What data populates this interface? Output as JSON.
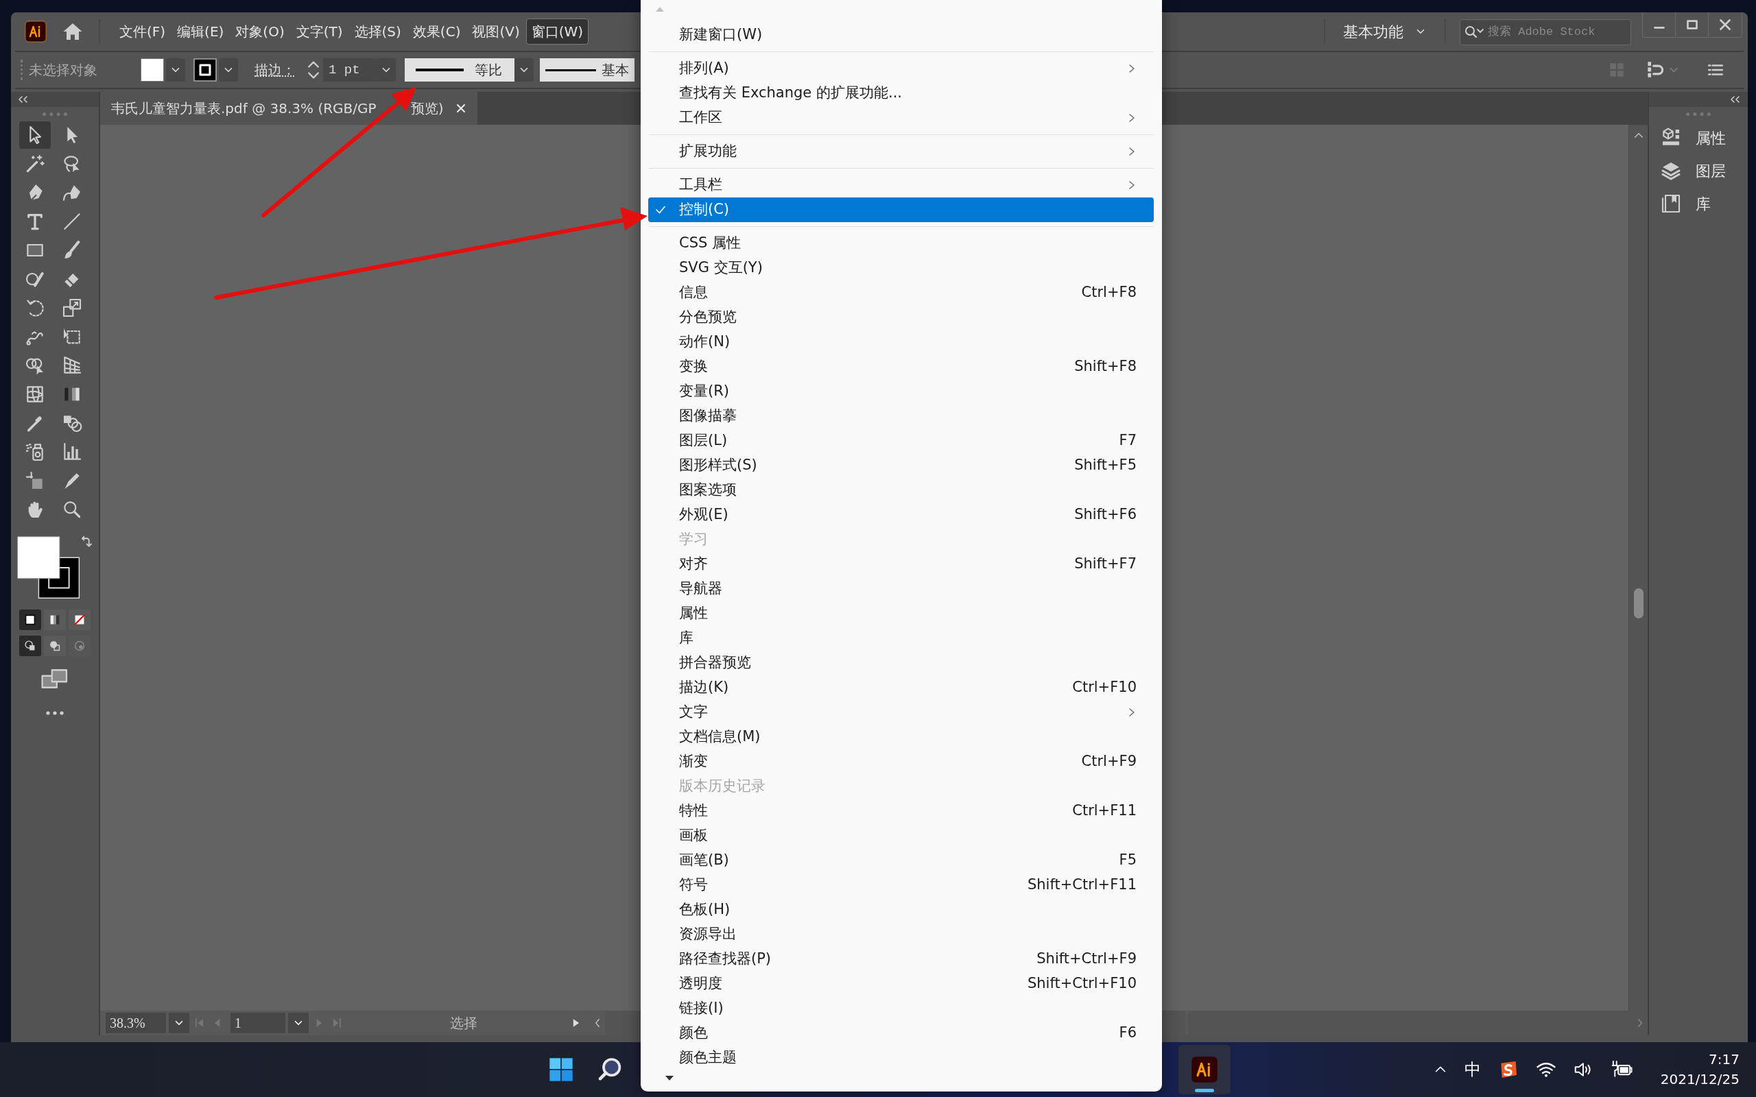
{
  "menu_bar": {
    "items": [
      {
        "label": "文件(F)",
        "selected": false
      },
      {
        "label": "编辑(E)",
        "selected": false
      },
      {
        "label": "对象(O)",
        "selected": false
      },
      {
        "label": "文字(T)",
        "selected": false
      },
      {
        "label": "选择(S)",
        "selected": false
      },
      {
        "label": "效果(C)",
        "selected": false
      },
      {
        "label": "视图(V)",
        "selected": false
      },
      {
        "label": "窗口(W)",
        "selected": true
      }
    ],
    "workspace": "基本功能",
    "search": {
      "placeholder": "搜索 Adobe Stock"
    }
  },
  "control_bar": {
    "selection": "未选择对象",
    "stroke_label": "描边：",
    "stroke_weight": "1 pt",
    "profile": "等比",
    "brush": "基本"
  },
  "document_tab": {
    "title_parts": [
      "韦氏儿童智力量表.pdf @ 38.3% (RGB/GP",
      "预览)"
    ]
  },
  "toolbar": {
    "tools": [
      {
        "kind": "selection",
        "selected": true
      },
      {
        "kind": "direct",
        "selected": false
      },
      {
        "kind": "wand",
        "selected": false
      },
      {
        "kind": "lasso",
        "selected": false
      },
      {
        "kind": "pen",
        "selected": false
      },
      {
        "kind": "curvature",
        "selected": false
      },
      {
        "kind": "type",
        "selected": false
      },
      {
        "kind": "line",
        "selected": false
      },
      {
        "kind": "rectangle",
        "selected": false
      },
      {
        "kind": "brush",
        "selected": false
      },
      {
        "kind": "shaper",
        "selected": false
      },
      {
        "kind": "eraser",
        "selected": false
      },
      {
        "kind": "rotate",
        "selected": false
      },
      {
        "kind": "scale",
        "selected": false
      },
      {
        "kind": "warp",
        "selected": false
      },
      {
        "kind": "free_transform",
        "selected": false
      },
      {
        "kind": "shape_builder",
        "selected": false
      },
      {
        "kind": "perspective",
        "selected": false
      },
      {
        "kind": "mesh",
        "selected": false
      },
      {
        "kind": "gradient",
        "selected": false
      },
      {
        "kind": "eyedropper",
        "selected": false
      },
      {
        "kind": "blend",
        "selected": false
      },
      {
        "kind": "sprayer",
        "selected": false
      },
      {
        "kind": "chart",
        "selected": false
      },
      {
        "kind": "artboard",
        "selected": false
      },
      {
        "kind": "knife",
        "selected": false
      },
      {
        "kind": "hand",
        "selected": false
      },
      {
        "kind": "zoom",
        "selected": false
      }
    ],
    "color_modes": [
      {
        "kind": "color",
        "selected": true
      },
      {
        "kind": "gradient",
        "selected": false
      },
      {
        "kind": "none",
        "selected": false
      }
    ],
    "draw_modes": [
      {
        "kind": "normal",
        "selected": true,
        "disabled": false
      },
      {
        "kind": "behind",
        "selected": false,
        "disabled": false
      },
      {
        "kind": "inside",
        "selected": false,
        "disabled": true
      }
    ]
  },
  "panels": [
    {
      "kind": "properties",
      "label": "属性"
    },
    {
      "kind": "layers",
      "label": "图层"
    },
    {
      "kind": "libraries",
      "label": "库"
    }
  ],
  "status_bar": {
    "zoom": "38.3%",
    "artboard": "1",
    "tool": "选择"
  },
  "window_menu": {
    "items": [
      {
        "kind": "item",
        "label": "新建窗口(W)",
        "submenu": false,
        "checked": false,
        "selected": false,
        "disabled": false
      },
      {
        "kind": "separator"
      },
      {
        "kind": "item",
        "label": "排列(A)",
        "submenu": true,
        "checked": false,
        "selected": false,
        "disabled": false
      },
      {
        "kind": "item",
        "label": "查找有关 Exchange 的扩展功能...",
        "submenu": false,
        "checked": false,
        "selected": false,
        "disabled": false
      },
      {
        "kind": "item",
        "label": "工作区",
        "submenu": true,
        "checked": false,
        "selected": false,
        "disabled": false
      },
      {
        "kind": "separator"
      },
      {
        "kind": "item",
        "label": "扩展功能",
        "submenu": true,
        "checked": false,
        "selected": false,
        "disabled": false
      },
      {
        "kind": "separator"
      },
      {
        "kind": "item",
        "label": "工具栏",
        "submenu": true,
        "checked": false,
        "selected": false,
        "disabled": false
      },
      {
        "kind": "item",
        "label": "控制(C)",
        "submenu": false,
        "checked": true,
        "selected": true,
        "disabled": false
      },
      {
        "kind": "separator"
      },
      {
        "kind": "item",
        "label": "CSS 属性",
        "submenu": false,
        "checked": false,
        "selected": false,
        "disabled": false
      },
      {
        "kind": "item",
        "label": "SVG 交互(Y)",
        "submenu": false,
        "checked": false,
        "selected": false,
        "disabled": false
      },
      {
        "kind": "item",
        "label": "信息",
        "shortcut": "Ctrl+F8",
        "submenu": false,
        "checked": false,
        "selected": false,
        "disabled": false
      },
      {
        "kind": "item",
        "label": "分色预览",
        "submenu": false,
        "checked": false,
        "selected": false,
        "disabled": false
      },
      {
        "kind": "item",
        "label": "动作(N)",
        "submenu": false,
        "checked": false,
        "selected": false,
        "disabled": false
      },
      {
        "kind": "item",
        "label": "变换",
        "shortcut": "Shift+F8",
        "submenu": false,
        "checked": false,
        "selected": false,
        "disabled": false
      },
      {
        "kind": "item",
        "label": "变量(R)",
        "submenu": false,
        "checked": false,
        "selected": false,
        "disabled": false
      },
      {
        "kind": "item",
        "label": "图像描摹",
        "submenu": false,
        "checked": false,
        "selected": false,
        "disabled": false
      },
      {
        "kind": "item",
        "label": "图层(L)",
        "shortcut": "F7",
        "submenu": false,
        "checked": false,
        "selected": false,
        "disabled": false
      },
      {
        "kind": "item",
        "label": "图形样式(S)",
        "shortcut": "Shift+F5",
        "submenu": false,
        "checked": false,
        "selected": false,
        "disabled": false
      },
      {
        "kind": "item",
        "label": "图案选项",
        "submenu": false,
        "checked": false,
        "selected": false,
        "disabled": false
      },
      {
        "kind": "item",
        "label": "外观(E)",
        "shortcut": "Shift+F6",
        "submenu": false,
        "checked": false,
        "selected": false,
        "disabled": false
      },
      {
        "kind": "item",
        "label": "学习",
        "submenu": false,
        "checked": false,
        "selected": false,
        "disabled": true
      },
      {
        "kind": "item",
        "label": "对齐",
        "shortcut": "Shift+F7",
        "submenu": false,
        "checked": false,
        "selected": false,
        "disabled": false
      },
      {
        "kind": "item",
        "label": "导航器",
        "submenu": false,
        "checked": false,
        "selected": false,
        "disabled": false
      },
      {
        "kind": "item",
        "label": "属性",
        "submenu": false,
        "checked": false,
        "selected": false,
        "disabled": false
      },
      {
        "kind": "item",
        "label": "库",
        "submenu": false,
        "checked": false,
        "selected": false,
        "disabled": false
      },
      {
        "kind": "item",
        "label": "拼合器预览",
        "submenu": false,
        "checked": false,
        "selected": false,
        "disabled": false
      },
      {
        "kind": "item",
        "label": "描边(K)",
        "shortcut": "Ctrl+F10",
        "submenu": false,
        "checked": false,
        "selected": false,
        "disabled": false
      },
      {
        "kind": "item",
        "label": "文字",
        "submenu": true,
        "checked": false,
        "selected": false,
        "disabled": false
      },
      {
        "kind": "item",
        "label": "文档信息(M)",
        "submenu": false,
        "checked": false,
        "selected": false,
        "disabled": false
      },
      {
        "kind": "item",
        "label": "渐变",
        "shortcut": "Ctrl+F9",
        "submenu": false,
        "checked": false,
        "selected": false,
        "disabled": false
      },
      {
        "kind": "item",
        "label": "版本历史记录",
        "submenu": false,
        "checked": false,
        "selected": false,
        "disabled": true
      },
      {
        "kind": "item",
        "label": "特性",
        "shortcut": "Ctrl+F11",
        "submenu": false,
        "checked": false,
        "selected": false,
        "disabled": false
      },
      {
        "kind": "item",
        "label": "画板",
        "submenu": false,
        "checked": false,
        "selected": false,
        "disabled": false
      },
      {
        "kind": "item",
        "label": "画笔(B)",
        "shortcut": "F5",
        "submenu": false,
        "checked": false,
        "selected": false,
        "disabled": false
      },
      {
        "kind": "item",
        "label": "符号",
        "shortcut": "Shift+Ctrl+F11",
        "submenu": false,
        "checked": false,
        "selected": false,
        "disabled": false
      },
      {
        "kind": "item",
        "label": "色板(H)",
        "submenu": false,
        "checked": false,
        "selected": false,
        "disabled": false
      },
      {
        "kind": "item",
        "label": "资源导出",
        "submenu": false,
        "checked": false,
        "selected": false,
        "disabled": false
      },
      {
        "kind": "item",
        "label": "路径查找器(P)",
        "shortcut": "Shift+Ctrl+F9",
        "submenu": false,
        "checked": false,
        "selected": false,
        "disabled": false
      },
      {
        "kind": "item",
        "label": "透明度",
        "shortcut": "Shift+Ctrl+F10",
        "submenu": false,
        "checked": false,
        "selected": false,
        "disabled": false
      },
      {
        "kind": "item",
        "label": "链接(I)",
        "submenu": false,
        "checked": false,
        "selected": false,
        "disabled": false
      },
      {
        "kind": "item",
        "label": "颜色",
        "shortcut": "F6",
        "submenu": false,
        "checked": false,
        "selected": false,
        "disabled": false
      },
      {
        "kind": "item",
        "label": "颜色主题",
        "submenu": false,
        "checked": false,
        "selected": false,
        "disabled": false
      }
    ]
  },
  "taskbar": {
    "ime": "中",
    "time": "7:17",
    "date": "2021/12/25"
  }
}
